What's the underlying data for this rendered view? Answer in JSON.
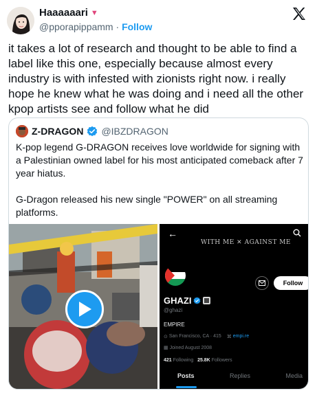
{
  "tweet": {
    "display_name": "Haaaaaari",
    "name_emoji": "heart-icon",
    "handle": "@pporapippamm",
    "separator": "·",
    "follow_label": "Follow",
    "text": "it takes a lot of research and thought to be able to find a label like this one, especially because almost every industry is with infested with zionists right now. i really hope he knew what he was doing and i need all the other kpop artists see and follow what he did"
  },
  "quote": {
    "name": "Z-DRAGON",
    "handle": "@IBZDRAGON",
    "paragraph1": "K-pop legend G-DRAGON receives love worldwide for signing with a Palestinian owned label for his most anticipated comeback after 7 year hiatus.",
    "paragraph2": "G-Dragon released his new single \"POWER\" on all streaming platforms."
  },
  "profile_screenshot": {
    "banner_text": "WITH ME ✕ AGAINST ME",
    "follow_label": "Follow",
    "name": "GHAZI",
    "handle": "@ghazi",
    "bio": "EMPIRE",
    "location": "San Francisco, CA · 415",
    "link": "empi.re",
    "joined": "Joined August 2008",
    "following_count": "421",
    "following_label": "Following",
    "followers_count": "25.8K",
    "followers_label": "Followers",
    "tabs": [
      "Posts",
      "Replies",
      "Media"
    ]
  },
  "colors": {
    "accent": "#1d9bf0",
    "text": "#0f1419",
    "secondary": "#536471",
    "heart": "#e0457b"
  }
}
